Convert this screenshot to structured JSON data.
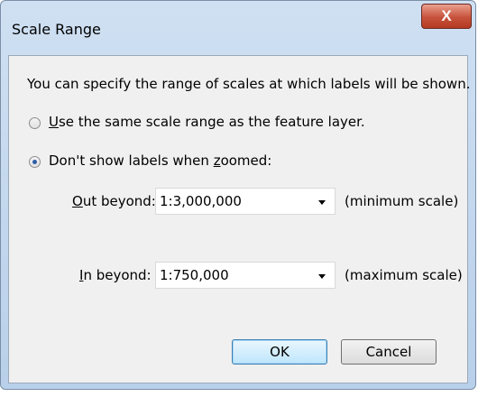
{
  "window": {
    "title": "Scale Range",
    "close_label": "X"
  },
  "description": "You can specify the range of scales at which labels will be shown.",
  "options": {
    "same_range": {
      "label_u": "U",
      "label_rest": "se the same scale range as the feature layer.",
      "checked": false
    },
    "dont_show": {
      "label_pre": "Don't show labels when ",
      "label_u": "z",
      "label_post": "oomed:",
      "checked": true
    }
  },
  "out_beyond": {
    "label_u": "O",
    "label_rest": "ut beyond:",
    "value": "1:3,000,000",
    "note": "(minimum scale)"
  },
  "in_beyond": {
    "label_u": "I",
    "label_rest": "n beyond:",
    "value": "1:750,000",
    "note": "(maximum scale)"
  },
  "buttons": {
    "ok": "OK",
    "cancel": "Cancel"
  }
}
